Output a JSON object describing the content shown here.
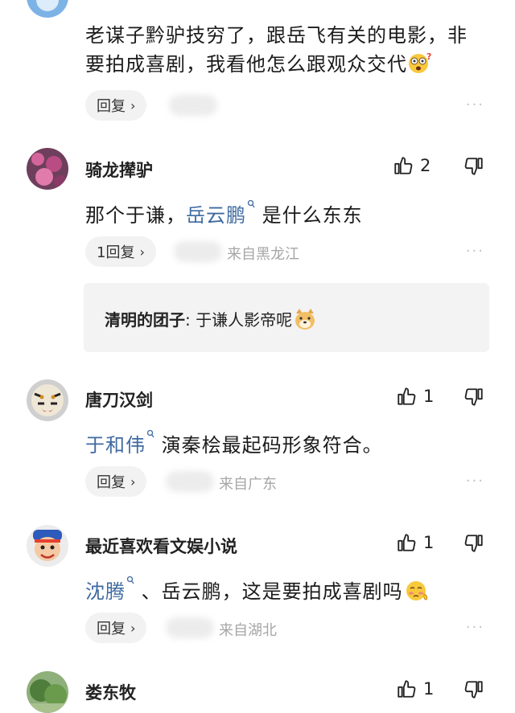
{
  "comments": [
    {
      "text_main": "老谋子黔驴技穷了，跟岳飞有关的电影，非",
      "text_second": "要拍成喜剧，我看他怎么跟观众交代",
      "reply_label": "回复",
      "more": "···"
    },
    {
      "username": "骑龙撵驴",
      "likes": "2",
      "text_prefix": "那个于谦，",
      "mention": "岳云鹏",
      "text_suffix": " 是什么东东",
      "reply_label": "1回复",
      "location": "来自黑龙江",
      "more": "···",
      "quote_name": "清明的团子",
      "quote_sep": ": ",
      "quote_text": "于谦人影帝呢"
    },
    {
      "username": "唐刀汉剑",
      "likes": "1",
      "mention": "于和伟",
      "text_suffix": " 演秦桧最起码形象符合。",
      "reply_label": "回复",
      "location": "来自广东",
      "more": "···"
    },
    {
      "username": "最近喜欢看文娱小说",
      "likes": "1",
      "mention": "沈腾",
      "text_suffix": " 、岳云鹏，这是要拍成喜剧吗",
      "reply_label": "回复",
      "location": "来自湖北",
      "more": "···"
    },
    {
      "username": "娄东牧",
      "likes": "1"
    }
  ],
  "icons": {
    "like": "thumbs-up-icon",
    "dislike": "thumbs-down-icon",
    "chevron": "chevron-right-icon",
    "mention_mark": "search-mark-icon"
  },
  "colors": {
    "mention": "#3f6aa1",
    "pill_bg": "#f2f2f2",
    "quote_bg": "#f3f3f3",
    "location": "#a6a6a6"
  }
}
